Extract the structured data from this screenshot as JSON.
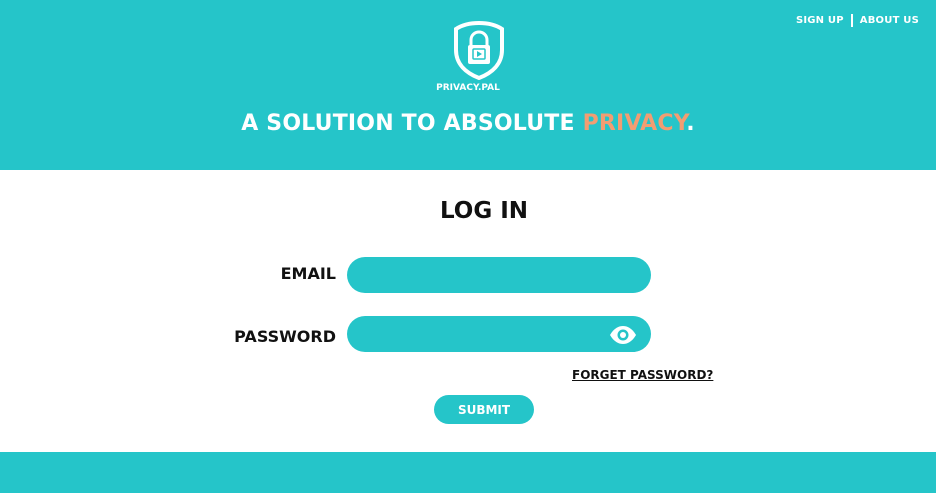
{
  "nav": {
    "signup_label": "SIGN UP",
    "about_label": "ABOUT US"
  },
  "brand": {
    "name": "PRIVACY.PAL",
    "logo_icon": "shield-lock-icon"
  },
  "tagline": {
    "before": "A SOLUTION TO ABSOLUTE ",
    "accent": "PRIVACY",
    "after": "."
  },
  "login": {
    "title": "LOG IN",
    "email_label": "EMAIL",
    "email_value": "",
    "password_label": "PASSWORD",
    "password_value": "",
    "show_password_icon": "eye-icon",
    "forgot_label": "FORGET PASSWORD?",
    "submit_label": "SUBMIT"
  },
  "colors": {
    "primary": "#25c5c9",
    "accent": "#f29d72",
    "text": "#111111"
  }
}
